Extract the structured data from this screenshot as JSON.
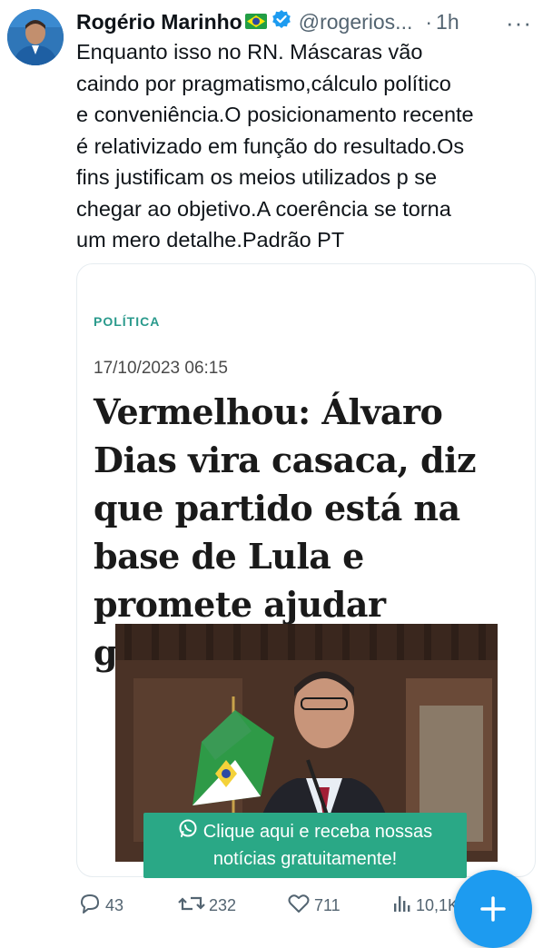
{
  "tweet": {
    "author_name": "Rogério Marinho",
    "handle": "@rogerios...",
    "separator": "·",
    "time": "1h",
    "more_label": "···",
    "text": "Enquanto isso no RN. Máscaras vão\ncaindo por pragmatismo,cálculo político\ne conveniência.O posicionamento recente\né relativizado em função do resultado.Os\nfins justificam os meios utilizados p se\nchegar ao objetivo.A coerência se torna\num mero detalhe.Padrão PT"
  },
  "card": {
    "category": "POLÍTICA",
    "date": "17/10/2023 06:15",
    "headline": "Vermelhou: Álvaro Dias vira casaca, diz que partido está na base de Lula e promete ajudar governo",
    "cta_line1": "Clique aqui e receba nossas",
    "cta_line2": "notícias gratuitamente!"
  },
  "actions": {
    "replies": "43",
    "reposts": "232",
    "likes": "711",
    "views": "10,1K"
  },
  "icons": [
    "brazil-flag-icon",
    "verified-badge-icon",
    "more-icon",
    "whatsapp-icon",
    "reply-icon",
    "repost-icon",
    "like-icon",
    "views-icon",
    "plus-icon"
  ],
  "colors": {
    "accent": "#1d9bf0",
    "cta_green": "#2aa886",
    "category_teal": "#2a9a8c",
    "muted_text": "#536471"
  }
}
